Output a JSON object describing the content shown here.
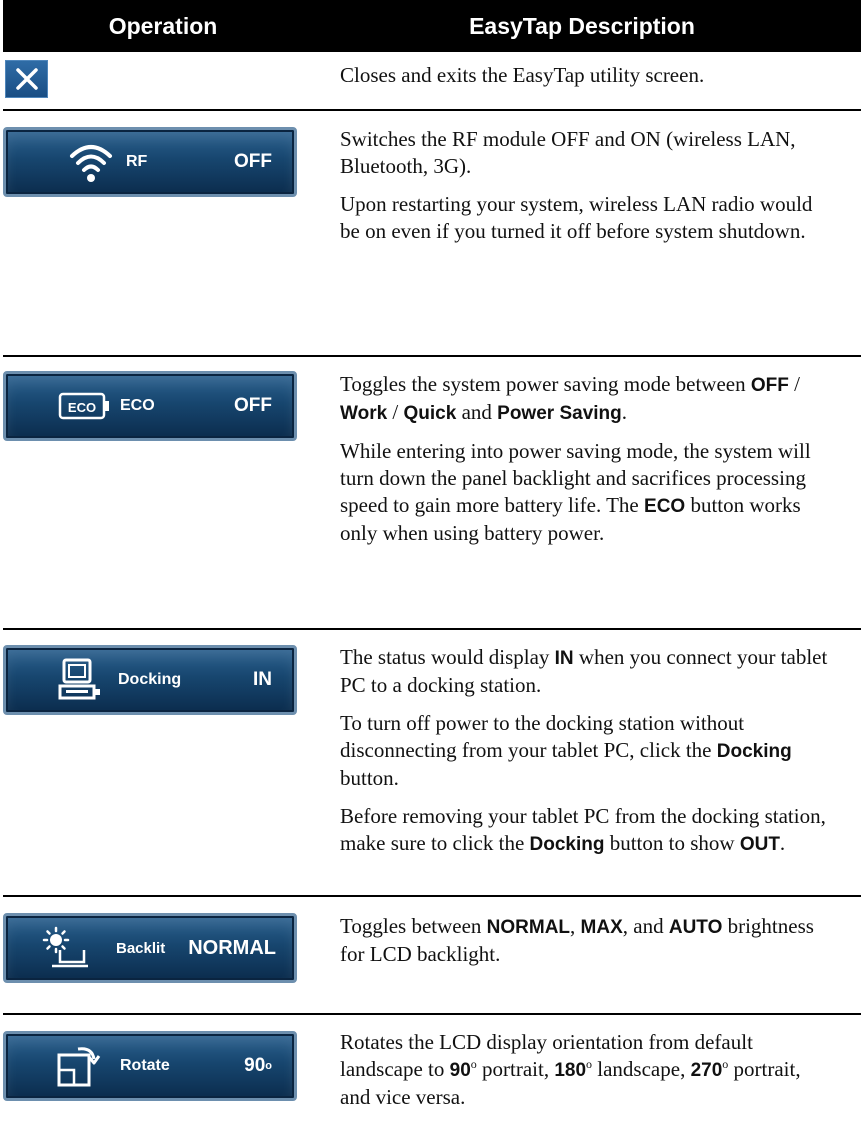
{
  "header": {
    "operation": "Operation",
    "description": "EasyTap Description"
  },
  "close_row": {
    "icon": "close-icon",
    "desc": "Closes and exits the EasyTap utility screen."
  },
  "rf": {
    "label": "RF",
    "status": "OFF",
    "icon": "wifi-icon",
    "desc1": "Switches the RF module OFF and ON (wireless LAN, Bluetooth, 3G).",
    "desc2": "Upon restarting your system, wireless LAN radio would be on even if you turned it off before system shutdown."
  },
  "eco": {
    "label": "ECO",
    "status": "OFF",
    "icon": "eco-battery-icon",
    "icon_text": "ECO",
    "d1a": "Toggles the system power saving mode between ",
    "d1b": "OFF",
    "d1c": " / ",
    "d1d": "Work",
    "d1e": " / ",
    "d1f": "Quick",
    "d1g": " and ",
    "d1h": "Power Saving",
    "d1i": ".",
    "d2a": "While entering into power saving mode, the system will turn down the panel backlight and sacrifices processing speed to gain more battery life. The ",
    "d2b": "ECO",
    "d2c": " button works only when using battery power."
  },
  "docking": {
    "label": "Docking",
    "status": "IN",
    "icon": "docking-icon",
    "d1a": "The status would display ",
    "d1b": "IN",
    "d1c": " when you connect your tablet PC to a docking station.",
    "d2a": "To turn off power to the docking station without disconnecting from your tablet PC, click the ",
    "d2b": "Docking",
    "d2c": " button.",
    "d3a": "Before removing your tablet PC from the docking station, make sure to click the ",
    "d3b": "Docking",
    "d3c": " button to show ",
    "d3d": "OUT",
    "d3e": "."
  },
  "backlit": {
    "label": "Backlit",
    "status": "NORMAL",
    "icon": "backlight-sun-icon",
    "d1a": "Toggles between ",
    "d1b": "NORMAL",
    "d1c": ", ",
    "d1d": "MAX",
    "d1e": ", and ",
    "d1f": "AUTO",
    "d1g": " brightness for LCD backlight."
  },
  "rotate": {
    "label": "Rotate",
    "status": "90",
    "status_sup": "o",
    "icon": "rotate-screen-icon",
    "d1a": "Rotates the LCD display orientation from default landscape to ",
    "d1b": "90",
    "d1c": "o",
    "d1d": " portrait, ",
    "d1e": "180",
    "d1f": "o",
    "d1g": " landscape, ",
    "d1h": "270",
    "d1i": "o",
    "d1j": " portrait, and vice versa."
  }
}
